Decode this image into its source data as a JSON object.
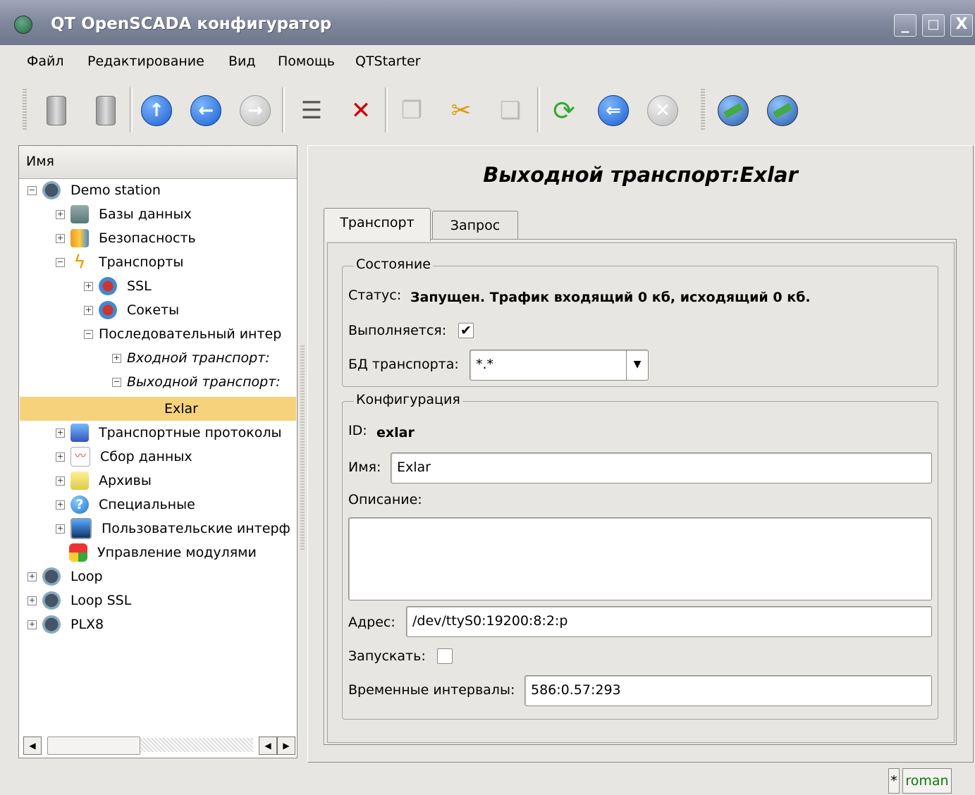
{
  "window": {
    "title": "QT OpenSCADA конфигуратор",
    "controls": [
      "_",
      "□",
      "X"
    ]
  },
  "menu": [
    "Файл",
    "Редактирование",
    "Вид",
    "Помощь",
    "QTStarter"
  ],
  "toolbar": {
    "icons": [
      "load-db-icon",
      "save-db-icon",
      "up-icon",
      "back-icon",
      "forward-icon",
      "add-item-icon",
      "delete-item-icon",
      "copy-icon",
      "cut-icon",
      "paste-icon",
      "refresh-icon",
      "start-icon",
      "stop-icon",
      "station-icon",
      "station-alt-icon"
    ]
  },
  "tree": {
    "header": "Имя",
    "nodes": [
      {
        "label": "Demo station",
        "expanded": true
      },
      {
        "label": "Базы данных"
      },
      {
        "label": "Безопасность"
      },
      {
        "label": "Транспорты",
        "expanded": true
      },
      {
        "label": "SSL"
      },
      {
        "label": "Сокеты"
      },
      {
        "label": "Последовательный интер",
        "expanded": true
      },
      {
        "label": "Входной транспорт:"
      },
      {
        "label": "Выходной транспорт:",
        "expanded": true
      },
      {
        "label": "Exlar",
        "selected": true
      },
      {
        "label": "Транспортные протоколы"
      },
      {
        "label": "Сбор данных"
      },
      {
        "label": "Архивы"
      },
      {
        "label": "Специальные"
      },
      {
        "label": "Пользовательские интерф"
      },
      {
        "label": "Управление модулями"
      },
      {
        "label": "Loop"
      },
      {
        "label": "Loop SSL"
      },
      {
        "label": "PLX8"
      }
    ]
  },
  "page": {
    "title": "Выходной транспорт:Exlar",
    "tabs": [
      "Транспорт",
      "Запрос"
    ],
    "state": {
      "group_title": "Состояние",
      "status_label": "Статус:",
      "status_value": "Запущен. Трафик входящий 0 кб, исходящий 0 кб.",
      "running_label": "Выполняется:",
      "running_checked": true,
      "db_label": "БД транспорта:",
      "db_value": "*.*"
    },
    "config": {
      "group_title": "Конфигурация",
      "id_label": "ID:",
      "id_value": "exlar",
      "name_label": "Имя:",
      "name_value": "Exlar",
      "desc_label": "Описание:",
      "desc_value": "",
      "addr_label": "Адрес:",
      "addr_value": "/dev/ttyS0:19200:8:2:p",
      "start_label": "Запускать:",
      "start_checked": false,
      "intervals_label": "Временные интервалы:",
      "intervals_value": "586:0.57:293"
    }
  },
  "statusbar": {
    "indicator": "*",
    "user": "roman"
  },
  "colors": {
    "selection": "#f6d27a",
    "titlebar": "#7f879c",
    "user_text": "#0a7a0a"
  }
}
